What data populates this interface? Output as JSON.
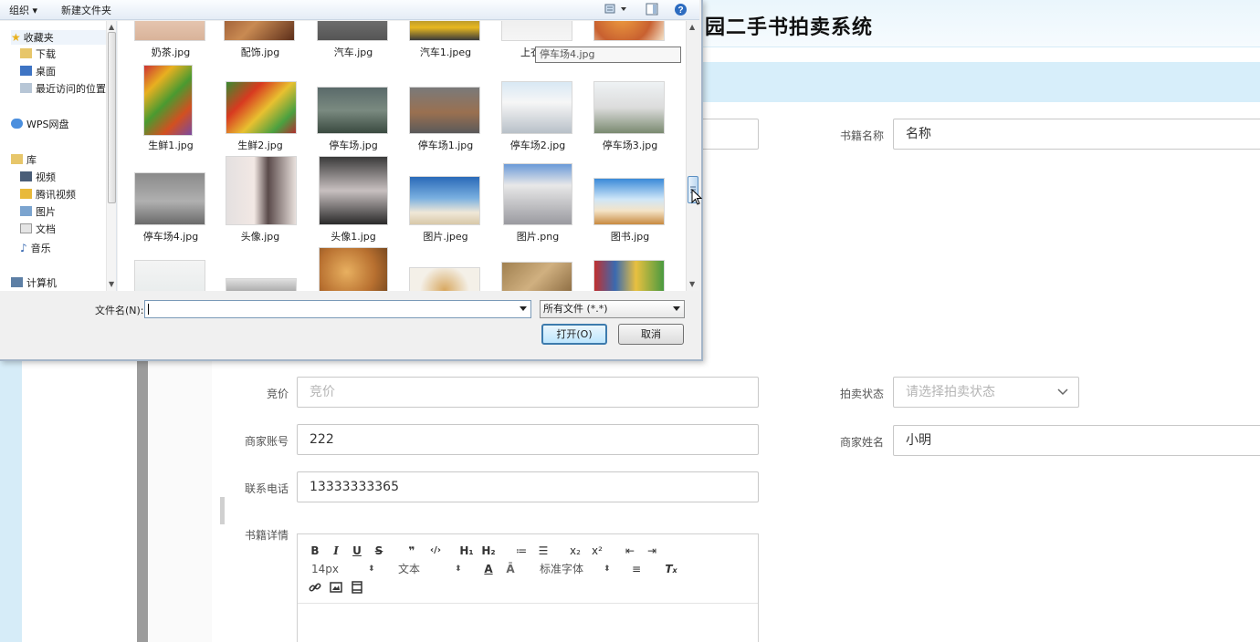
{
  "app": {
    "title": "园二手书拍卖系统"
  },
  "form": {
    "name_label": "书籍名称",
    "name_placeholder": "名称",
    "bid_label": "竞价",
    "bid_placeholder": "竞价",
    "status_label": "拍卖状态",
    "status_placeholder": "请选择拍卖状态",
    "merchant_account_label": "商家账号",
    "merchant_account_value": "222",
    "merchant_name_label": "商家姓名",
    "merchant_name_value": "小明",
    "phone_label": "联系电话",
    "phone_value": "13333333365",
    "details_label": "书籍详情"
  },
  "editor": {
    "row1": [
      "B",
      "I",
      "U",
      "S",
      "❞",
      "‹/›",
      "H₁",
      "H₂",
      "≔",
      "☰",
      "x₂",
      "x²",
      "⇤",
      "⇥"
    ],
    "font_size": "14px",
    "text_style": "文本",
    "font_family": "标准字体"
  },
  "dialog": {
    "toolbar": {
      "organize": "组织 ▾",
      "new_folder": "新建文件夹"
    },
    "nav": {
      "favorites": "收藏夹",
      "downloads": "下载",
      "desktop": "桌面",
      "recent": "最近访问的位置",
      "wps": "WPS网盘",
      "libraries": "库",
      "videos": "视频",
      "tencent_video": "腾讯视频",
      "pictures": "图片",
      "documents": "文档",
      "music": "音乐",
      "computer": "计算机"
    },
    "files": {
      "row0": [
        "奶茶.jpg",
        "配饰.jpg",
        "汽车.jpg",
        "汽车1.jpeg",
        "上衣"
      ],
      "row1": [
        "生鲜1.jpg",
        "生鲜2.jpg",
        "停车场.jpg",
        "停车场1.jpg",
        "停车场2.jpg",
        "停车场3.jpg"
      ],
      "row2": [
        "停车场4.jpg",
        "头像.jpg",
        "头像1.jpg",
        "图片.jpeg",
        "图片.png",
        "图书.jpg"
      ]
    },
    "tooltip": "停车场4.jpg",
    "filename_label": "文件名(N):",
    "filename_value": "",
    "filetype": "所有文件 (*.*)",
    "open_button": "打开(O)",
    "cancel_button": "取消"
  },
  "colors": {
    "header_bg": "#eaf6fc",
    "subbar_bg": "#d7eefa",
    "dialog_bg": "#f0f0f0",
    "accent_border": "#3d7bad"
  }
}
